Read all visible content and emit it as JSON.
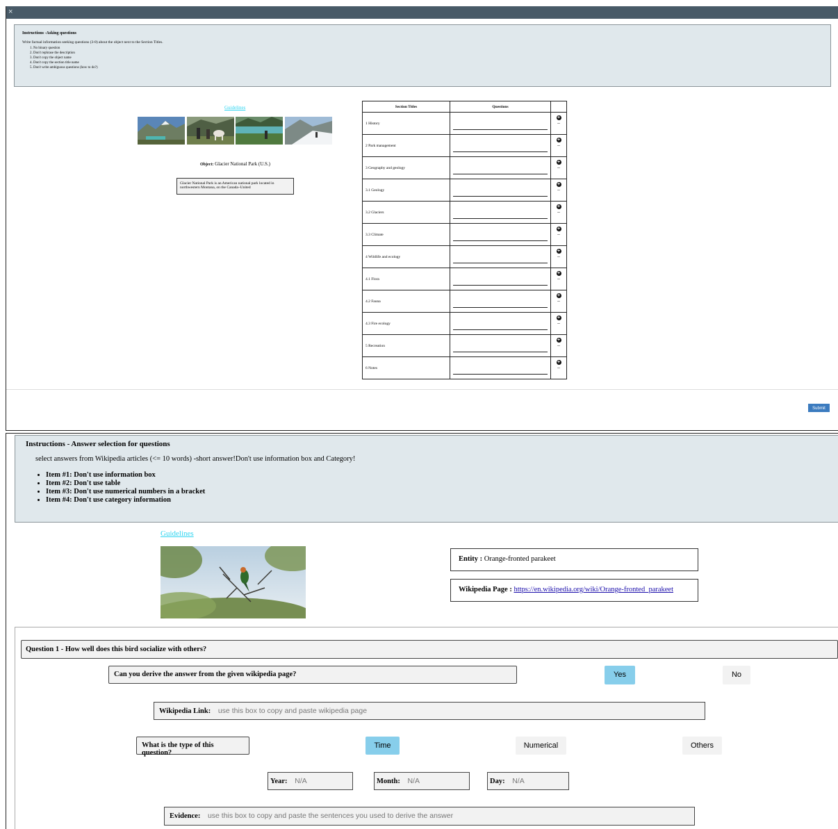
{
  "top_panel": {
    "close_symbol": "×",
    "instructions": {
      "title": "Instructions -Asking questions",
      "description": "Write factual information seeking questions (3-8) about the object next to the Section Titles.",
      "rules": [
        "No binary question",
        "Don't rephrase the description",
        "Don't copy the object name",
        "Don't copy the section title name",
        "Don't write ambiguous questions (how to do?)"
      ]
    },
    "guidelines_link": "Guidelines",
    "object_label": "Object:",
    "object_name": "Glacier National Park (U.S.)",
    "object_description": "Glacier National Park is an American national park located in northwestern Montana, on the Canada–United",
    "table": {
      "headers": [
        "Section Titles",
        "Questions"
      ],
      "sections": [
        "1 History",
        "2 Park management",
        "3 Geography and geology",
        "3.1 Geology",
        "3.2 Glaciers",
        "3.3 Climate",
        "4 Wildlife and ecology",
        "4.1 Flora",
        "4.2 Fauna",
        "4.3 Fire ecology",
        "5 Recreation",
        "6 Notes"
      ]
    },
    "submit_label": "Submit",
    "colors": {
      "titlebar": "#485a67",
      "instructions_bg": "#e0e8ec",
      "submit": "#3b7bbf",
      "link": "#2dd4f0"
    }
  },
  "bottom_panel": {
    "instructions": {
      "title": "Instructions - Answer selection for questions",
      "description": "select answers from Wikipedia articles (<= 10 words) -short answer!Don't use information box and Category!",
      "items": [
        "Item #1: Don't use information box",
        "Item #2: Don't use table",
        "Item #3: Don't use numerical numbers in a bracket",
        "Item #4: Don't use category information"
      ]
    },
    "guidelines_link": "Guidelines",
    "entity_label": "Entity :",
    "entity_value": "Orange-fronted parakeet",
    "wiki_label": "Wikipedia Page :",
    "wiki_url": "https://en.wikipedia.org/wiki/Orange-fronted_parakeet",
    "question_title": "Question 1 - How well does this bird socialize with others?",
    "derive_prompt": "Can you derive the answer from the given wikipedia page?",
    "derive_options": {
      "yes": "Yes",
      "no": "No"
    },
    "wiki_link_label": "Wikipedia Link:",
    "wiki_link_placeholder": "use this box to copy and paste wikipedia page",
    "type_prompt": "What is the type of this question?",
    "type_options": {
      "time": "Time",
      "numerical": "Numerical",
      "others": "Others"
    },
    "year_label": "Year:",
    "year_value": "N/A",
    "month_label": "Month:",
    "month_value": "N/A",
    "day_label": "Day:",
    "day_value": "N/A",
    "evidence_label": "Evidence:",
    "evidence_placeholder": "use this box to copy and paste the sentences you used to derive the answer",
    "colors": {
      "selected": "#87ceeb",
      "unselected": "#f2f2f2"
    }
  }
}
